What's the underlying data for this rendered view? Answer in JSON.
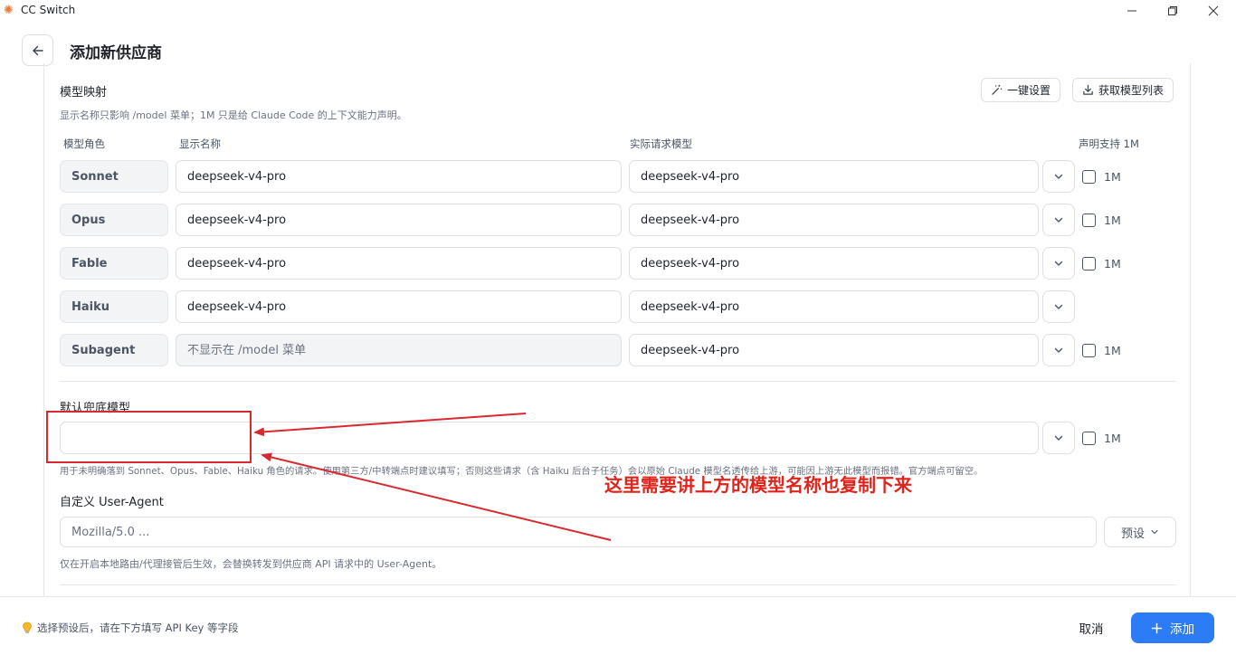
{
  "window": {
    "title": "CC Switch",
    "logo_icon": "sun-flower-icon"
  },
  "header": {
    "title": "添加新供应商"
  },
  "model_mapping": {
    "title": "模型映射",
    "hint": "显示名称只影响 /model 菜单；1M 只是给 Claude Code 的上下文能力声明。",
    "one_click_label": "一键设置",
    "fetch_list_label": "获取模型列表",
    "columns": {
      "role": "模型角色",
      "display": "显示名称",
      "actual": "实际请求模型",
      "support": "声明支持 1M"
    },
    "rows": [
      {
        "role": "Sonnet",
        "display": "deepseek-v4-pro",
        "actual": "deepseek-v4-pro",
        "has_1m": true,
        "check_label": "1M"
      },
      {
        "role": "Opus",
        "display": "deepseek-v4-pro",
        "actual": "deepseek-v4-pro",
        "has_1m": true,
        "check_label": "1M"
      },
      {
        "role": "Fable",
        "display": "deepseek-v4-pro",
        "actual": "deepseek-v4-pro",
        "has_1m": true,
        "check_label": "1M"
      },
      {
        "role": "Haiku",
        "display": "deepseek-v4-pro",
        "actual": "deepseek-v4-pro",
        "has_1m": false
      },
      {
        "role": "Subagent",
        "display_placeholder": "不显示在 /model 菜单",
        "actual": "deepseek-v4-pro",
        "has_1m": true,
        "check_label": "1M"
      }
    ]
  },
  "fallback": {
    "title": "默认兜底模型",
    "value": "",
    "check_label": "1M",
    "hint": "用于未明确落到 Sonnet、Opus、Fable、Haiku 角色的请求。使用第三方/中转端点时建议填写；否则这些请求（含 Haiku 后台子任务）会以原始 Claude 模型名透传给上游，可能因上游无此模型而报错。官方端点可留空。"
  },
  "user_agent": {
    "title": "自定义 User-Agent",
    "placeholder": "Mozilla/5.0 ...",
    "preset_label": "预设",
    "hint": "仅在开启本地路由/代理接管后生效，会替换转发到供应商 API 请求中的 User-Agent。"
  },
  "annotation": {
    "text": "这里需要讲上方的模型名称也复制下来",
    "color": "#e0241b"
  },
  "footer": {
    "tip": "选择预设后，请在下方填写 API Key 等字段",
    "cancel_label": "取消",
    "add_label": "添加"
  },
  "colors": {
    "accent": "#2b7cf6",
    "annotation": "#d9282f"
  }
}
